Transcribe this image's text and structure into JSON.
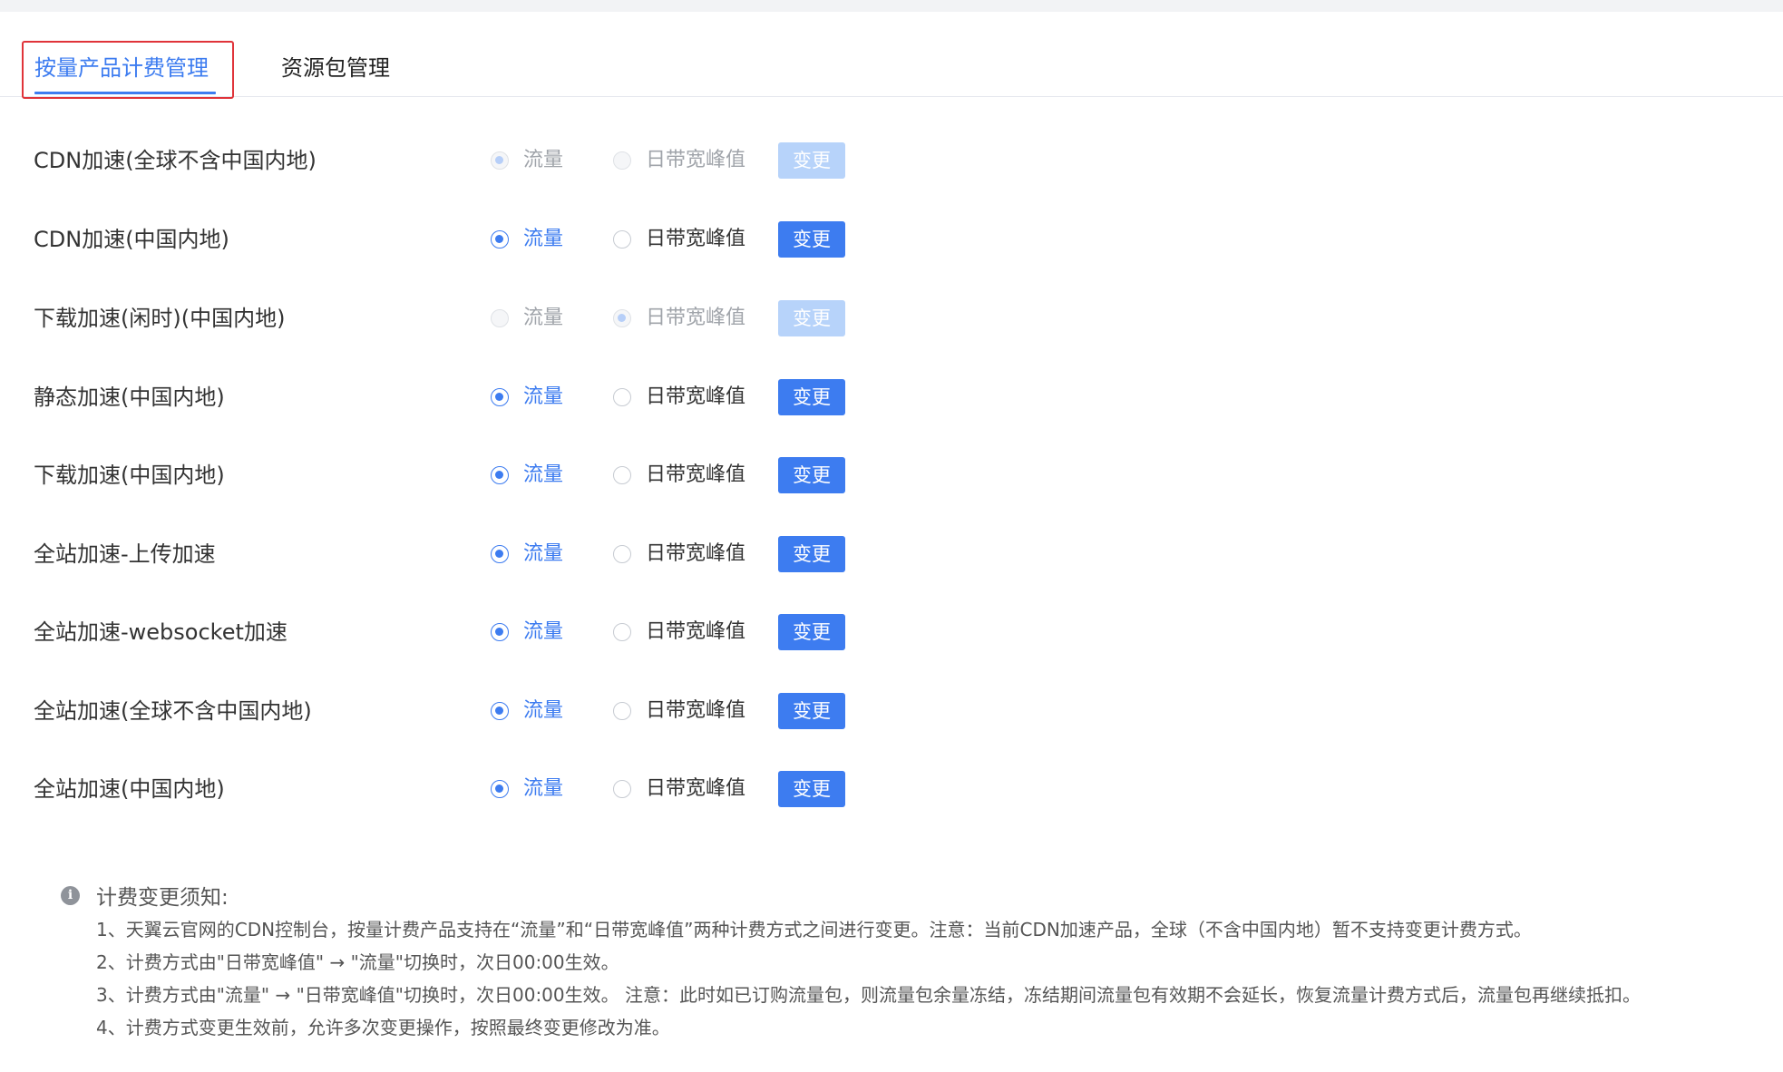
{
  "tabs": [
    {
      "label": "按量产品计费管理",
      "active": true
    },
    {
      "label": "资源包管理",
      "active": false
    }
  ],
  "billing_rows": [
    {
      "product": "CDN加速(全球不含中国内地)",
      "option_flow": "流量",
      "option_bandwidth": "日带宽峰值",
      "selected": "flow",
      "disabled": true,
      "button": "变更"
    },
    {
      "product": "CDN加速(中国内地)",
      "option_flow": "流量",
      "option_bandwidth": "日带宽峰值",
      "selected": "flow",
      "disabled": false,
      "button": "变更"
    },
    {
      "product": "下载加速(闲时)(中国内地)",
      "option_flow": "流量",
      "option_bandwidth": "日带宽峰值",
      "selected": "bandwidth",
      "disabled": true,
      "button": "变更"
    },
    {
      "product": "静态加速(中国内地)",
      "option_flow": "流量",
      "option_bandwidth": "日带宽峰值",
      "selected": "flow",
      "disabled": false,
      "button": "变更"
    },
    {
      "product": "下载加速(中国内地)",
      "option_flow": "流量",
      "option_bandwidth": "日带宽峰值",
      "selected": "flow",
      "disabled": false,
      "button": "变更"
    },
    {
      "product": "全站加速-上传加速",
      "option_flow": "流量",
      "option_bandwidth": "日带宽峰值",
      "selected": "flow",
      "disabled": false,
      "button": "变更"
    },
    {
      "product": "全站加速-websocket加速",
      "option_flow": "流量",
      "option_bandwidth": "日带宽峰值",
      "selected": "flow",
      "disabled": false,
      "button": "变更"
    },
    {
      "product": "全站加速(全球不含中国内地)",
      "option_flow": "流量",
      "option_bandwidth": "日带宽峰值",
      "selected": "flow",
      "disabled": false,
      "button": "变更"
    },
    {
      "product": "全站加速(中国内地)",
      "option_flow": "流量",
      "option_bandwidth": "日带宽峰值",
      "selected": "flow",
      "disabled": false,
      "button": "变更"
    }
  ],
  "notice": {
    "icon": "info-icon",
    "title": "计费变更须知:",
    "lines": [
      "1、天翼云官网的CDN控制台，按量计费产品支持在“流量”和“日带宽峰值”两种计费方式之间进行变更。注意：当前CDN加速产品，全球（不含中国内地）暂不支持变更计费方式。",
      "2、计费方式由\"日带宽峰值\" → \"流量\"切换时，次日00:00生效。",
      "3、计费方式由\"流量\" → \"日带宽峰值\"切换时，次日00:00生效。 注意：此时如已订购流量包，则流量包余量冻结，冻结期间流量包有效期不会延长，恢复流量计费方式后，流量包再继续抵扣。",
      "4、计费方式变更生效前，允许多次变更操作，按照最终变更修改为准。"
    ]
  },
  "colors": {
    "accent": "#3d7cf0",
    "disabled_button": "#b7d3fa",
    "focus_outline": "#e0343a"
  }
}
